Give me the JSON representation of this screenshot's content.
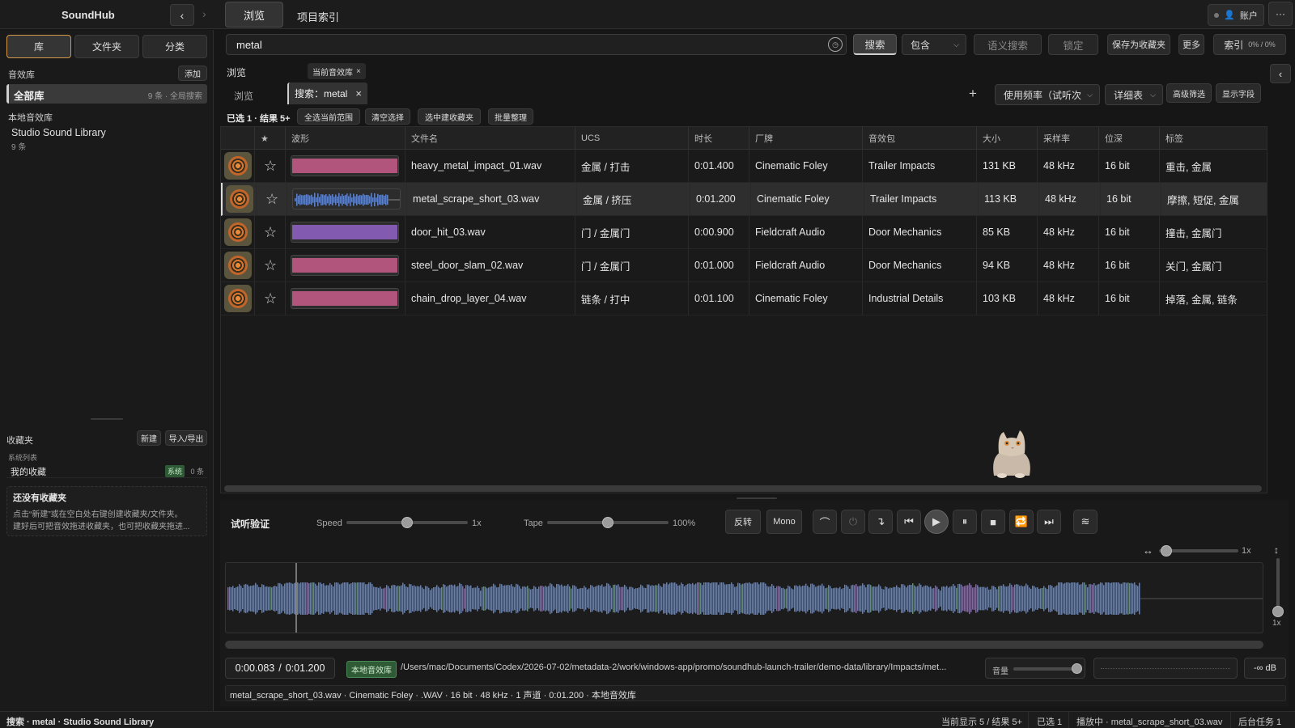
{
  "app": {
    "name": "SoundHub"
  },
  "top_tabs": {
    "browse": "浏览",
    "project_index": "项目索引",
    "account": "账户"
  },
  "sidebar": {
    "tabs": [
      "库",
      "文件夹",
      "分类"
    ],
    "library_section": "音效库",
    "add_label": "添加",
    "all_library": {
      "label": "全部库",
      "meta": "9 条 · 全局搜索"
    },
    "local_section": "本地音效库",
    "local_lib": {
      "name": "Studio Sound Library",
      "count": "9 条"
    },
    "favorites": {
      "title": "收藏夹",
      "new_label": "新建",
      "import_label": "导入/导出",
      "system_list": "系统列表",
      "my_fav": "我的收藏",
      "badge": "系统",
      "count": "0 条",
      "empty_title": "还没有收藏夹",
      "empty_desc1": "点击“新建”或在空白处右键创建收藏夹/文件夹。",
      "empty_desc2": "建好后可把音效拖进收藏夹，也可把收藏夹拖进..."
    }
  },
  "search": {
    "query": "metal",
    "search_btn": "搜索",
    "mode": "包含",
    "semantic": "语义搜索",
    "lock": "锁定",
    "save_fav": "保存为收藏夹",
    "more": "更多",
    "index_label": "索引",
    "index_pct": "0% / 0%"
  },
  "browse": {
    "title": "浏览",
    "scope_chip": "当前音效库",
    "sub_tabs": {
      "browse": "浏览",
      "search": "搜索：metal"
    },
    "sort_select": "使用频率（试听次",
    "view_select": "详细表",
    "advanced": "高级筛选",
    "show_fields": "显示字段",
    "selection_info": "已选 1 · 结果 5+",
    "select_all": "全选当前范围",
    "clear_sel": "清空选择",
    "add_to_fav": "选中建收藏夹",
    "batch": "批量整理"
  },
  "table": {
    "headers": {
      "star": "★",
      "wave": "波形",
      "file": "文件名",
      "ucs": "UCS",
      "duration": "时长",
      "vendor": "厂牌",
      "pack": "音效包",
      "size": "大小",
      "rate": "采样率",
      "depth": "位深",
      "tags": "标签"
    },
    "rows": [
      {
        "file": "heavy_metal_impact_01.wav",
        "ucs": "金属 / 打击",
        "duration": "0:01.400",
        "vendor": "Cinematic Foley",
        "pack": "Trailer Impacts",
        "size": "131 KB",
        "rate": "48 kHz",
        "depth": "16 bit",
        "tags": "重击, 金属"
      },
      {
        "file": "metal_scrape_short_03.wav",
        "ucs": "金属 / 挤压",
        "duration": "0:01.200",
        "vendor": "Cinematic Foley",
        "pack": "Trailer Impacts",
        "size": "113 KB",
        "rate": "48 kHz",
        "depth": "16 bit",
        "tags": "摩擦, 短促, 金属"
      },
      {
        "file": "door_hit_03.wav",
        "ucs": "门 / 金属门",
        "duration": "0:00.900",
        "vendor": "Fieldcraft Audio",
        "pack": "Door Mechanics",
        "size": "85 KB",
        "rate": "48 kHz",
        "depth": "16 bit",
        "tags": "撞击, 金属门"
      },
      {
        "file": "steel_door_slam_02.wav",
        "ucs": "门 / 金属门",
        "duration": "0:01.000",
        "vendor": "Fieldcraft Audio",
        "pack": "Door Mechanics",
        "size": "94 KB",
        "rate": "48 kHz",
        "depth": "16 bit",
        "tags": "关门, 金属门"
      },
      {
        "file": "chain_drop_layer_04.wav",
        "ucs": "链条 / 打中",
        "duration": "0:01.100",
        "vendor": "Cinematic Foley",
        "pack": "Industrial Details",
        "size": "103 KB",
        "rate": "48 kHz",
        "depth": "16 bit",
        "tags": "掉落, 金属, 链条"
      }
    ]
  },
  "player": {
    "title": "试听验证",
    "speed_label": "Speed",
    "speed_val": "1x",
    "speed_level": 0.5,
    "tape_label": "Tape",
    "tape_val": "100%",
    "tape_level": 0.5,
    "reverse": "反转",
    "mono": "Mono",
    "zoom_val": "1x",
    "vzoom_val": "1x",
    "time_current": "0:00.083",
    "time_sep": "/",
    "time_total": "0:01.200",
    "lib_badge": "本地音效库",
    "path": "/Users/mac/Documents/Codex/2026-07-02/metadata-2/work/windows-app/promo/soundhub-launch-trailer/demo-data/library/Impacts/met...",
    "volume_label": "音量",
    "db": "-∞ dB",
    "file_info": "metal_scrape_short_03.wav · Cinematic Foley · .WAV · 16 bit · 48 kHz · 1 声道 · 0:01.200 · 本地音效库"
  },
  "status": {
    "left": "搜索 · metal · Studio Sound Library",
    "showing": "当前显示 5 / 结果 5+",
    "selected": "已选 1",
    "playing": "播放中 · metal_scrape_short_03.wav",
    "tasks": "后台任务 1"
  },
  "colors": {
    "accent": "#3a78c8",
    "wave_pink": "#c05a86",
    "wave_blue": "#5d7fc4",
    "wave_purple": "#8c5fbf",
    "badge_green": "#2f6b3a"
  }
}
